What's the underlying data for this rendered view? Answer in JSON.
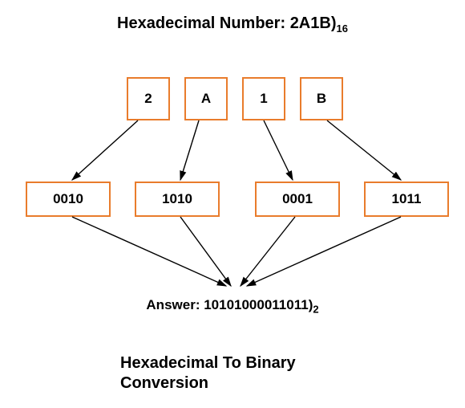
{
  "title_prefix": "Hexadecimal Number: ",
  "title_value": "2A1B)",
  "title_sub": "16",
  "hex_digits": [
    "2",
    "A",
    "1",
    "B"
  ],
  "binary_groups": [
    "0010",
    "1010",
    "0001",
    "1011"
  ],
  "answer_prefix": "Answer: ",
  "answer_value": "10101000011011)",
  "answer_sub": "2",
  "footer_line1": "Hexadecimal To Binary",
  "footer_line2": "Conversion",
  "colors": {
    "box_border": "#e97c2c"
  }
}
